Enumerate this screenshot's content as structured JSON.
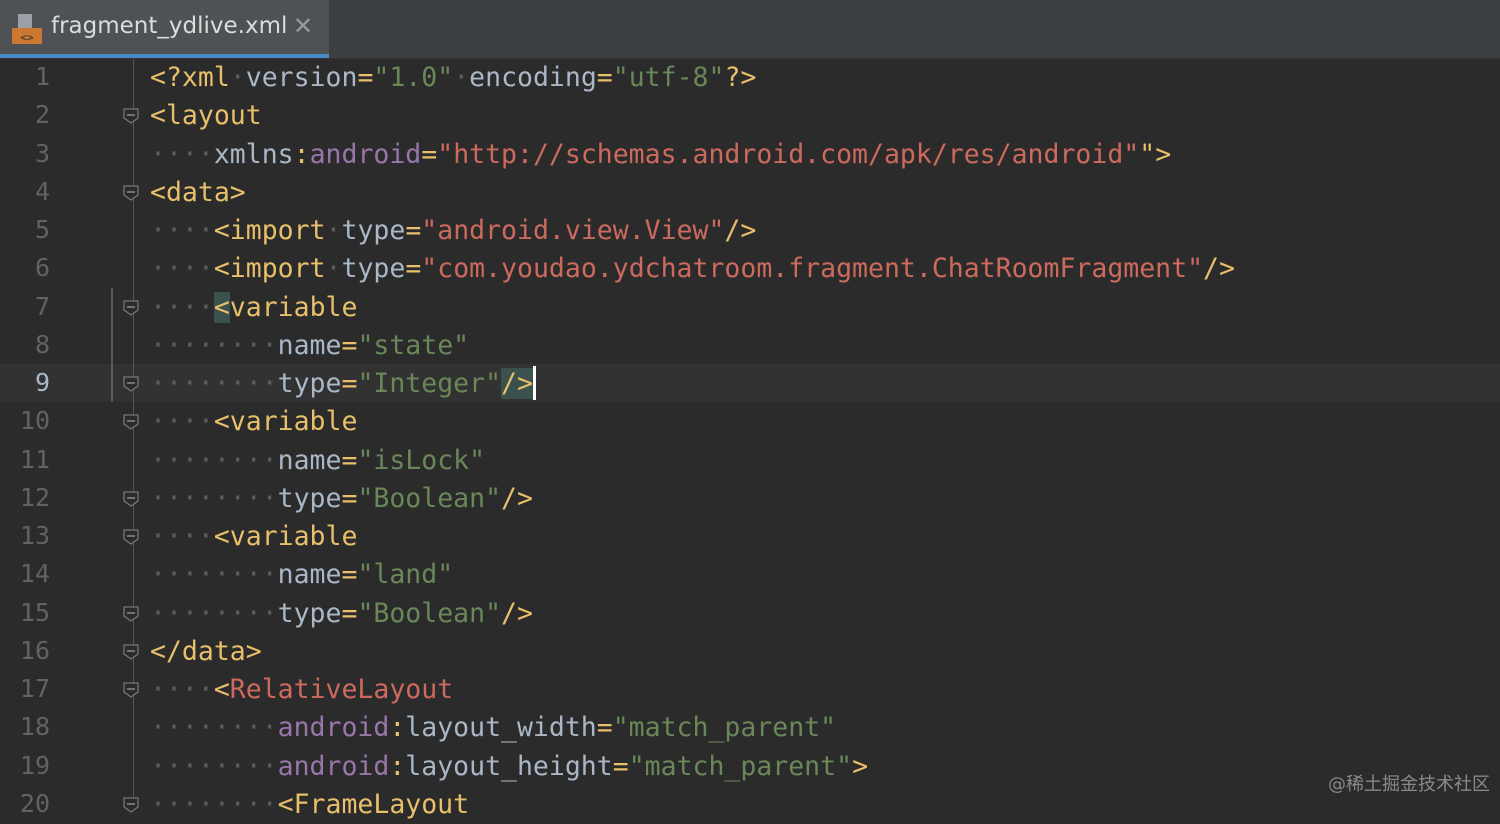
{
  "tab": {
    "filename": "fragment_ydlive.xml",
    "close_glyph": "✕",
    "icon": "xml-file-icon"
  },
  "editor": {
    "current_line": 9,
    "lines": [
      {
        "n": "1",
        "tokens": [
          [
            "tg",
            "<?xml"
          ],
          [
            "ws",
            "·"
          ],
          [
            "tx",
            "version"
          ],
          [
            "tg",
            "="
          ],
          [
            "st",
            "\"1.0\""
          ],
          [
            "ws",
            "·"
          ],
          [
            "tx",
            "encoding"
          ],
          [
            "tg",
            "="
          ],
          [
            "st",
            "\"utf-8\""
          ],
          [
            "tg",
            "?>"
          ]
        ]
      },
      {
        "n": "2",
        "tokens": [
          [
            "tg",
            "<layout"
          ]
        ]
      },
      {
        "n": "3",
        "tokens": [
          [
            "ws",
            "····"
          ],
          [
            "tx",
            "xmlns"
          ],
          [
            "tg",
            ":"
          ],
          [
            "ns",
            "android"
          ],
          [
            "tg",
            "="
          ],
          [
            "url",
            "\"http://schemas.android.com/apk/res/android\""
          ],
          [
            "tg",
            "\">"
          ]
        ]
      },
      {
        "n": "4",
        "tokens": [
          [
            "tg",
            "<data>"
          ]
        ]
      },
      {
        "n": "5",
        "tokens": [
          [
            "ws",
            "····"
          ],
          [
            "tg",
            "<import"
          ],
          [
            "ws",
            "·"
          ],
          [
            "tx",
            "type"
          ],
          [
            "tg",
            "="
          ],
          [
            "url",
            "\"android.view.View\""
          ],
          [
            "tg",
            "/>"
          ]
        ]
      },
      {
        "n": "6",
        "tokens": [
          [
            "ws",
            "····"
          ],
          [
            "tg",
            "<import"
          ],
          [
            "ws",
            "·"
          ],
          [
            "tx",
            "type"
          ],
          [
            "tg",
            "="
          ],
          [
            "url",
            "\"com.youdao.ydchatroom.fragment.ChatRoomFragment\""
          ],
          [
            "tg",
            "/>"
          ]
        ]
      },
      {
        "n": "7",
        "tokens": [
          [
            "ws",
            "····"
          ],
          [
            "hltg",
            "<"
          ],
          [
            "tg",
            "variable"
          ]
        ]
      },
      {
        "n": "8",
        "tokens": [
          [
            "ws",
            "········"
          ],
          [
            "tx",
            "name"
          ],
          [
            "tg",
            "="
          ],
          [
            "st",
            "\"state\""
          ]
        ]
      },
      {
        "n": "9",
        "tokens": [
          [
            "ws",
            "········"
          ],
          [
            "tx",
            "type"
          ],
          [
            "tg",
            "="
          ],
          [
            "st",
            "\"Integer\""
          ],
          [
            "hltg",
            "/>"
          ],
          [
            "cursor",
            ""
          ]
        ]
      },
      {
        "n": "10",
        "tokens": [
          [
            "ws",
            "····"
          ],
          [
            "tg",
            "<variable"
          ]
        ]
      },
      {
        "n": "11",
        "tokens": [
          [
            "ws",
            "········"
          ],
          [
            "tx",
            "name"
          ],
          [
            "tg",
            "="
          ],
          [
            "st",
            "\"isLock\""
          ]
        ]
      },
      {
        "n": "12",
        "tokens": [
          [
            "ws",
            "········"
          ],
          [
            "tx",
            "type"
          ],
          [
            "tg",
            "="
          ],
          [
            "st",
            "\"Boolean\""
          ],
          [
            "tg",
            "/>"
          ]
        ]
      },
      {
        "n": "13",
        "tokens": [
          [
            "ws",
            "····"
          ],
          [
            "tg",
            "<variable"
          ]
        ]
      },
      {
        "n": "14",
        "tokens": [
          [
            "ws",
            "········"
          ],
          [
            "tx",
            "name"
          ],
          [
            "tg",
            "="
          ],
          [
            "st",
            "\"land\""
          ]
        ]
      },
      {
        "n": "15",
        "tokens": [
          [
            "ws",
            "········"
          ],
          [
            "tx",
            "type"
          ],
          [
            "tg",
            "="
          ],
          [
            "st",
            "\"Boolean\""
          ],
          [
            "tg",
            "/>"
          ]
        ]
      },
      {
        "n": "16",
        "tokens": [
          [
            "tg",
            "</data>"
          ]
        ]
      },
      {
        "n": "17",
        "tokens": [
          [
            "ws",
            "····"
          ],
          [
            "tg",
            "<"
          ],
          [
            "rt",
            "RelativeLayout"
          ]
        ]
      },
      {
        "n": "18",
        "tokens": [
          [
            "ws",
            "········"
          ],
          [
            "ns",
            "android"
          ],
          [
            "tg",
            ":"
          ],
          [
            "tx",
            "layout_width"
          ],
          [
            "tg",
            "="
          ],
          [
            "st",
            "\"match_parent\""
          ]
        ]
      },
      {
        "n": "19",
        "tokens": [
          [
            "ws",
            "········"
          ],
          [
            "ns",
            "android"
          ],
          [
            "tg",
            ":"
          ],
          [
            "tx",
            "layout_height"
          ],
          [
            "tg",
            "="
          ],
          [
            "st",
            "\"match_parent\""
          ],
          [
            "tg",
            ">"
          ]
        ]
      },
      {
        "n": "20",
        "tokens": [
          [
            "ws",
            "········"
          ],
          [
            "tg",
            "<FrameLayout"
          ]
        ]
      }
    ],
    "fold_lines": [
      2,
      4,
      7,
      9,
      10,
      12,
      13,
      15,
      16,
      17,
      20
    ]
  },
  "colors": {
    "background": "#2b2b2b",
    "tag": "#e8bf6a",
    "attribute": "#a9b7c6",
    "string_value": "#6a8759",
    "url_value": "#cc6a5d",
    "namespace": "#9876aa",
    "tab_underline": "#4a88c7"
  },
  "watermark": "@稀土掘金技术社区"
}
